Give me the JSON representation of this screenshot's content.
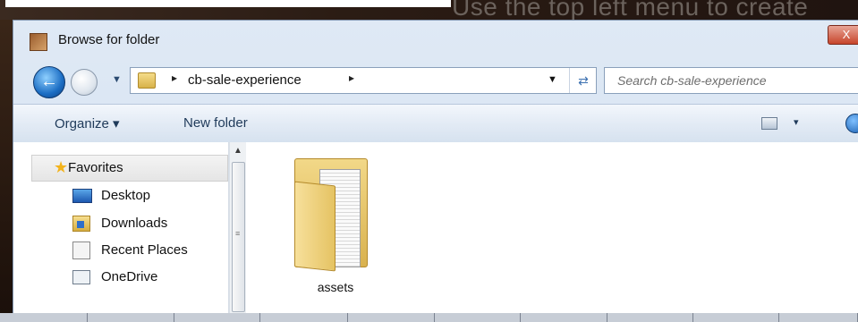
{
  "background": {
    "hint_text": "Use the top left menu to create",
    "taskbar_count": 10
  },
  "dialog": {
    "title": "Browse for folder",
    "title_icon": "folder-browse-icon",
    "close_label": "X"
  },
  "address_bar": {
    "path": "cb-sale-experience",
    "path_separator": "▸",
    "search_placeholder": "Search cb-sale-experience",
    "search_value": ""
  },
  "command_bar": {
    "organize_label": "Organize ▾",
    "new_folder_label": "New folder",
    "view_dropdown": "▾"
  },
  "navigation": {
    "favorites_label": "Favorites",
    "items": [
      {
        "label": "Desktop",
        "icon": "desktop-icon"
      },
      {
        "label": "Downloads",
        "icon": "downloads-icon"
      },
      {
        "label": "Recent Places",
        "icon": "recent-places-icon"
      },
      {
        "label": "OneDrive",
        "icon": "onedrive-icon"
      }
    ]
  },
  "content": {
    "items": [
      {
        "name": "assets",
        "type": "folder"
      }
    ]
  },
  "colors": {
    "accent": "#1c6ec4",
    "command_bar_text": "#1f3a5a",
    "close_button": "#c7452b",
    "folder": "#e5c363"
  }
}
